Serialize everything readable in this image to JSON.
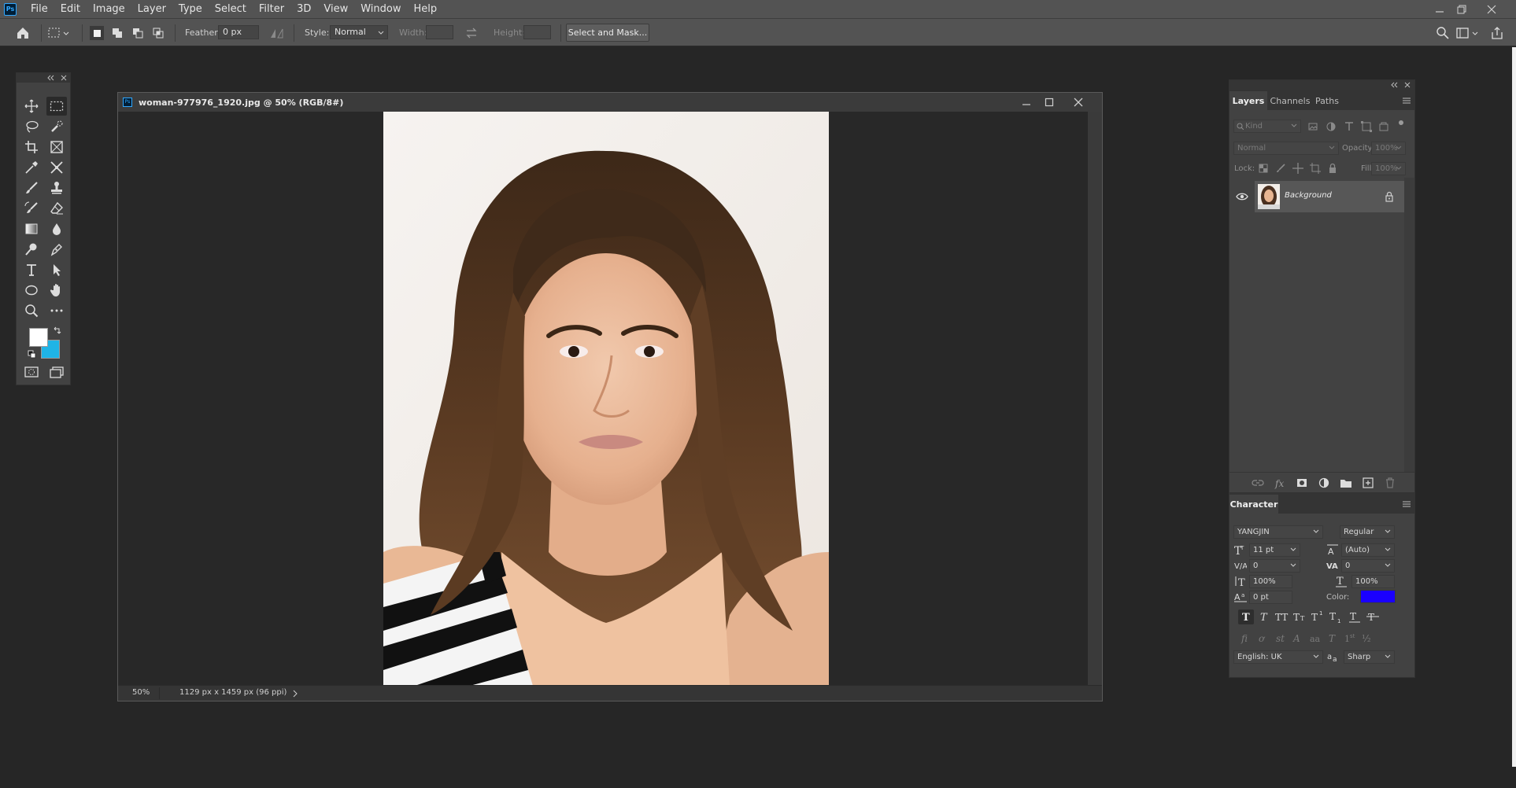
{
  "app": {
    "logo_text": "Ps"
  },
  "menu": [
    "File",
    "Edit",
    "Image",
    "Layer",
    "Type",
    "Select",
    "Filter",
    "3D",
    "View",
    "Window",
    "Help"
  ],
  "options": {
    "feather_label": "Feather:",
    "feather_value": "0 px",
    "style_label": "Style:",
    "style_value": "Normal",
    "width_label": "Width:",
    "height_label": "Height:",
    "select_mask_label": "Select and Mask..."
  },
  "document": {
    "title": "woman-977976_1920.jpg @ 50% (RGB/8#)",
    "zoom": "50%",
    "info": "1129 px x 1459 px (96 ppi)",
    "image_alt": "Portrait photo of a woman with long wavy brown hair"
  },
  "colors": {
    "foreground": "#ffffff",
    "background": "#1fb4e6",
    "text_color": "#1a00ff",
    "accent": "#31a8ff"
  },
  "layers": {
    "tabs": [
      "Layers",
      "Channels",
      "Paths"
    ],
    "kind_placeholder": "Kind",
    "blend_mode": "Normal",
    "opacity_label": "Opacity:",
    "opacity_value": "100%",
    "lock_label": "Lock:",
    "fill_label": "Fill:",
    "fill_value": "100%",
    "items": [
      {
        "name": "Background",
        "visible": true,
        "locked": true
      }
    ]
  },
  "character": {
    "tab": "Character",
    "font_family": "YANGJIN",
    "font_style": "Regular",
    "size": "11 pt",
    "leading": "(Auto)",
    "kerning": "0",
    "tracking": "0",
    "vertical_scale": "100%",
    "horizontal_scale": "100%",
    "baseline_shift": "0 pt",
    "color_label": "Color:",
    "language": "English: UK",
    "antialias": "Sharp"
  }
}
